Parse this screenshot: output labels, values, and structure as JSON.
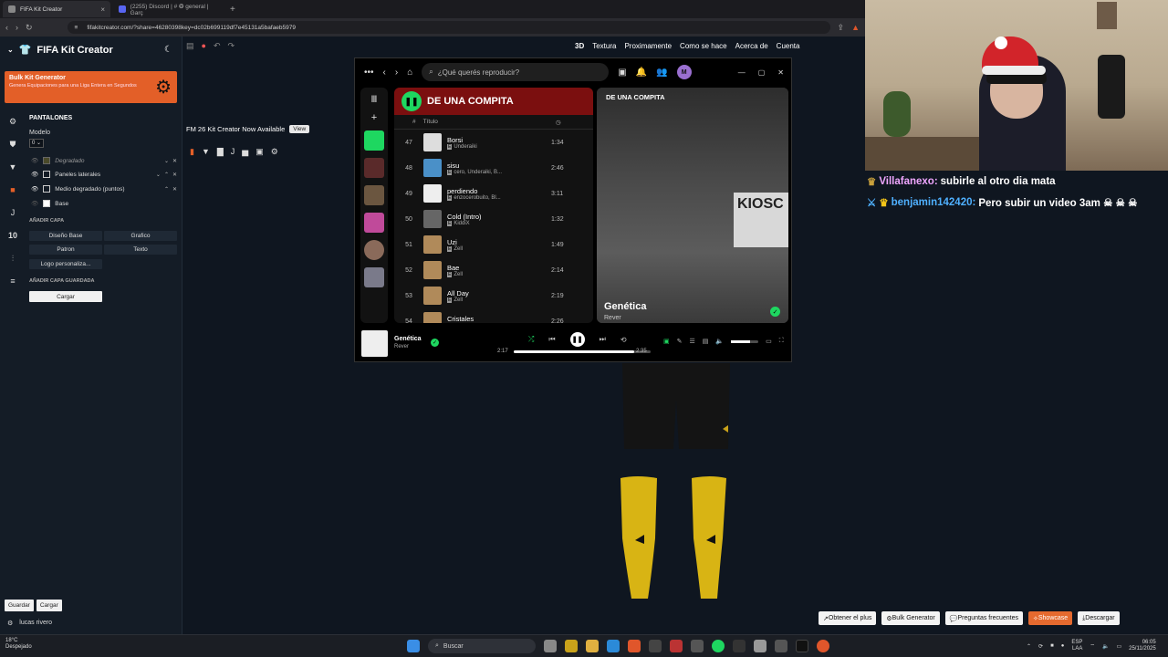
{
  "browser": {
    "tabs": [
      {
        "label": "FIFA Kit Creator",
        "active": true
      },
      {
        "label": "(2255) Discord | # ❂ general | Garç"
      }
    ],
    "url": "fifakitcreator.com/?share=46280398key=dc02b699119df7e45131a5bafaeb5979"
  },
  "app": {
    "title": "FIFA Kit Creator",
    "promo": {
      "title": "Bulk Kit Generator",
      "description": "Genera Equipaciones para una Liga Entera en Segundos"
    },
    "section_title": "PANTALONES",
    "modelo_label": "Modelo",
    "modelo_value": "0",
    "layers": [
      {
        "label": "Degradado",
        "italic": true
      },
      {
        "label": "Paneles laterales"
      },
      {
        "label": "Medio degradado (puntos)"
      },
      {
        "label": "Base"
      }
    ],
    "add_layer_title": "AÑADIR CAPA",
    "add_buttons": {
      "base": "Diseño Base",
      "graphic": "Grafico",
      "pattern": "Patron",
      "text": "Texto",
      "logo": "Logo personaliza..."
    },
    "saved_layer_title": "AÑADIR CAPA GUARDADA",
    "load_button": "Cargar",
    "bottom_left": {
      "save": "Guardar",
      "load": "Cargar",
      "user": "lucas rivero"
    },
    "rail_number": "10",
    "topnav": [
      "3D",
      "Textura",
      "Proximamente",
      "Como se hace",
      "Acerca de",
      "Cuenta"
    ],
    "announcement": "FM 26 Kit Creator Now Available",
    "view_button": "View",
    "bottom_buttons": {
      "plus": "Obtener el plus",
      "bulk": "Bulk Generator",
      "faq": "Preguntas frecuentes",
      "showcase": "Showcase",
      "download": "Descargar"
    },
    "accent": "#e35f28"
  },
  "spotify": {
    "search_placeholder": "¿Qué querés reproducir?",
    "avatar": "M",
    "playlist_title": "DE UNA COMPITA",
    "col_hash": "#",
    "col_title": "Título",
    "tracks": [
      {
        "num": "47",
        "title": "Borsi",
        "artist": "Underaiki",
        "duration": "1:34",
        "color": "#ddd"
      },
      {
        "num": "48",
        "title": "sisu",
        "artist": "cero, Underaiki, B...",
        "duration": "2:46",
        "color": "#4a90c8"
      },
      {
        "num": "49",
        "title": "perdiendo",
        "artist": "enzocerobuito, Bl...",
        "duration": "3:11",
        "color": "#eee"
      },
      {
        "num": "50",
        "title": "Cold (Intro)",
        "artist": "KiddiX",
        "duration": "1:32",
        "color": "#666"
      },
      {
        "num": "51",
        "title": "Uzi",
        "artist": "Zell",
        "duration": "1:49",
        "color": "#b08a5a"
      },
      {
        "num": "52",
        "title": "Bae",
        "artist": "Zell",
        "duration": "2:14",
        "color": "#b08a5a"
      },
      {
        "num": "53",
        "title": "All Day",
        "artist": "Zell",
        "duration": "2:19",
        "color": "#b08a5a"
      },
      {
        "num": "54",
        "title": "Cristales",
        "artist": "",
        "duration": "2:26",
        "color": "#b08a5a"
      }
    ],
    "now_playing_header": "DE UNA COMPITA",
    "np_sign": "KIOSC",
    "now_playing": {
      "title": "Genética",
      "artist": "Rever"
    },
    "elapsed": "2:17",
    "total": "2:35",
    "progress": 0.88,
    "volume": 0.7,
    "accent": "#1ed760"
  },
  "chat": [
    {
      "user": "Villafanexo:",
      "message": "subirle al otro dia mata",
      "color": "#f0a6ff"
    },
    {
      "user": "benjamin142420:",
      "message": "Pero subir un video 3am ☠ ☠ ☠",
      "color": "#4fb0ff"
    }
  ],
  "taskbar": {
    "temp": "18°C",
    "weather": "Despejado",
    "search": "Buscar",
    "lang": "ESP",
    "lang2": "LAA",
    "time": "06:05",
    "date": "25/11/2025"
  }
}
